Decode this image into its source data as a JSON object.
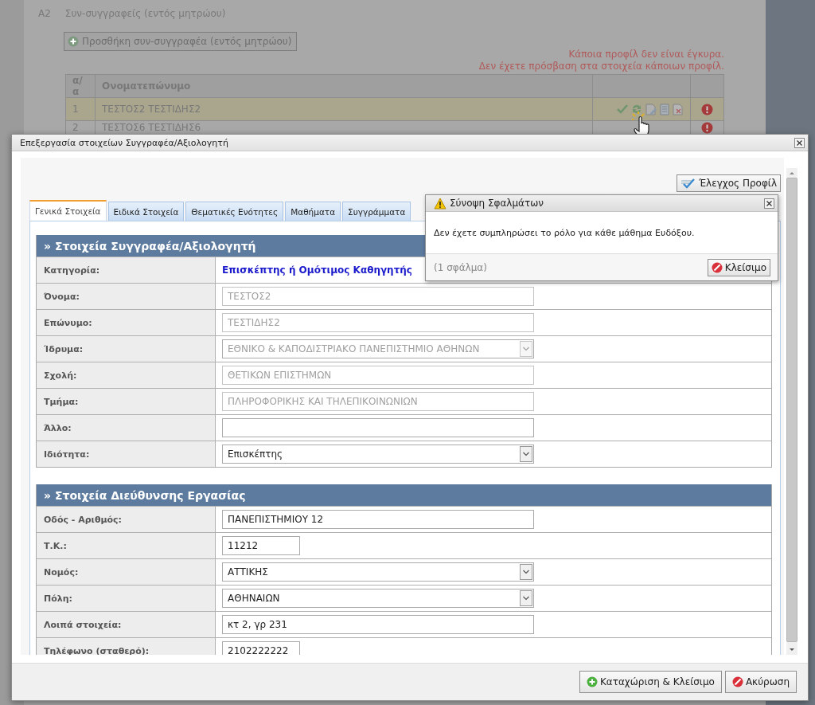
{
  "background_page": {
    "section_code": "A2",
    "section_title": "Συν-συγγραφείς (εντός μητρώου)",
    "add_button": "Προσθήκη συν-συγγραφέα (εντός μητρώου)",
    "warnings": [
      "Κάποια προφίλ δεν είναι έγκυρα.",
      "Δεν έχετε πρόσβαση στα στοιχεία κάποιων προφίλ."
    ],
    "table": {
      "columns": [
        "α/α",
        "Ονοματεπώνυμο"
      ],
      "rows": [
        {
          "number": "1",
          "name": "ΤΕΣΤΟΣ2 ΤΕΣΤΙΔΗΣ2",
          "selected": true,
          "has_actions": true,
          "has_error": true
        },
        {
          "number": "2",
          "name": "ΤΕΣΤΟΣ6 ΤΕΣΤΙΔΗΣ6",
          "selected": false,
          "has_actions": false,
          "has_error": true
        }
      ]
    }
  },
  "dialog": {
    "title": "Επεξεργασία στοιχείων Συγγραφέα/Αξιολογητή",
    "check_button": "Έλεγχος Προφίλ",
    "tabs": [
      {
        "label": "Γενικά Στοιχεία",
        "selected": true
      },
      {
        "label": "Ειδικά Στοιχεία",
        "selected": false
      },
      {
        "label": "Θεματικές Ενότητες",
        "selected": false
      },
      {
        "label": "Μαθήματα",
        "selected": false
      },
      {
        "label": "Συγγράμματα",
        "selected": false
      }
    ],
    "sections": [
      {
        "title": "» Στοιχεία Συγγραφέα/Αξιολογητή",
        "rows": [
          {
            "label": "Κατηγορία:",
            "kind": "text",
            "value": "Επισκέπτης ή Ομότιμος Καθηγητής"
          },
          {
            "label": "Όνομα:",
            "kind": "input",
            "value": "ΤΕΣΤΟΣ2",
            "disabled": true
          },
          {
            "label": "Επώνυμο:",
            "kind": "input",
            "value": "ΤΕΣΤΙΔΗΣ2",
            "disabled": true
          },
          {
            "label": "Ίδρυμα:",
            "kind": "select",
            "value": "ΕΘΝΙΚΟ & ΚΑΠΟΔΙΣΤΡΙΑΚΟ ΠΑΝΕΠΙΣΤΗΜΙΟ ΑΘΗΝΩΝ",
            "disabled": true
          },
          {
            "label": "Σχολή:",
            "kind": "input",
            "value": "ΘΕΤΙΚΩΝ ΕΠΙΣΤΗΜΩΝ",
            "disabled": true
          },
          {
            "label": "Τμήμα:",
            "kind": "input",
            "value": "ΠΛΗΡΟΦΟΡΙΚΗΣ ΚΑΙ ΤΗΛΕΠΙΚΟΙΝΩΝΙΩΝ",
            "disabled": true
          },
          {
            "label": "Άλλο:",
            "kind": "input",
            "disabled": false
          },
          {
            "label": "Ιδιότητα:",
            "kind": "select",
            "value": "Επισκέπτης",
            "disabled": false
          }
        ]
      },
      {
        "title": "» Στοιχεία Διεύθυνσης Εργασίας",
        "rows": [
          {
            "label": "Οδός - Αριθμός:",
            "kind": "input",
            "value": "ΠΑΝΕΠΙΣΤΗΜΙΟΥ 12",
            "disabled": false
          },
          {
            "label": "Τ.Κ.:",
            "kind": "short_input",
            "value": "11212",
            "disabled": false
          },
          {
            "label": "Νομός:",
            "kind": "select",
            "value": "ΑΤΤΙΚΗΣ",
            "disabled": false
          },
          {
            "label": "Πόλη:",
            "kind": "select",
            "value": "ΑΘΗΝΑΙΩΝ",
            "disabled": false
          },
          {
            "label": "Λοιπά στοιχεία:",
            "kind": "input",
            "value": "κτ 2, γρ 231",
            "disabled": false
          },
          {
            "label": "Τηλέφωνο (σταθερό):",
            "kind": "short_input",
            "value": "2102222222",
            "disabled": false
          }
        ]
      }
    ],
    "footer_buttons": [
      {
        "label": "Καταχώριση & Κλείσιμο",
        "kind": "save"
      },
      {
        "label": "Ακύρωση",
        "kind": "cancel"
      }
    ]
  },
  "error_popup": {
    "title": "Σύνοψη Σφαλμάτων",
    "message": "Δεν έχετε συμπληρώσει το ρόλο για κάθε μάθημα Ευδόξου.",
    "count": "(1 σφάλμα)",
    "close_button": "Κλείσιμο"
  }
}
